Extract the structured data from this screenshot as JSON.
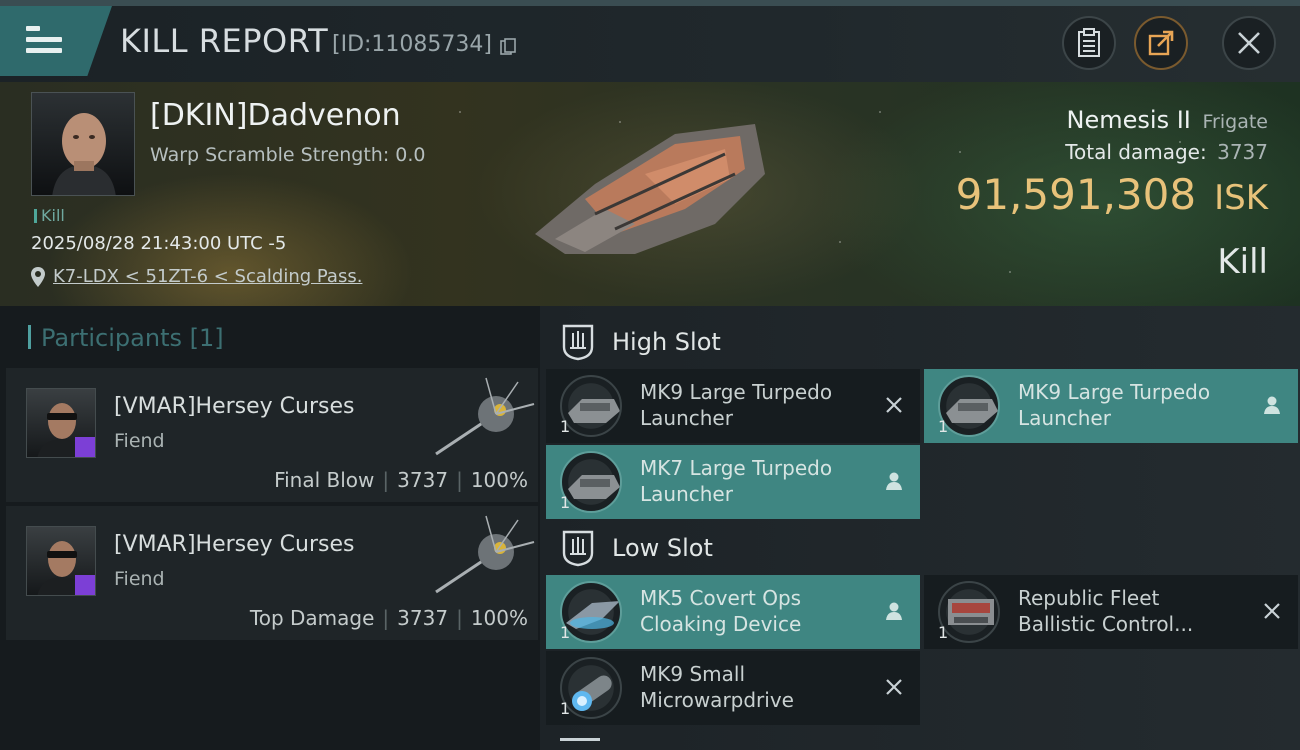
{
  "header": {
    "title": "KILL REPORT",
    "report_id": "[ID:11085734]"
  },
  "victim": {
    "pilot_name": "[DKIN]Dadvenon",
    "warp_scramble": "Warp Scramble Strength: 0.0",
    "kill_tag": "Kill",
    "datetime": "2025/08/28 21:43:00 UTC -5",
    "location": "K7-LDX < 51ZT-6 < Scalding Pass.",
    "ship_name": "Nemesis II",
    "ship_class": "Frigate",
    "total_damage_label": "Total damage:",
    "total_damage": "3737",
    "isk_value": "91,591,308",
    "isk_unit": "ISK",
    "result": "Kill"
  },
  "participants": {
    "header": "Participants [1]",
    "items": [
      {
        "name": "[VMAR]Hersey Curses",
        "ship": "Fiend",
        "role": "Final Blow",
        "damage": "3737",
        "percent": "100%"
      },
      {
        "name": "[VMAR]Hersey Curses",
        "ship": "Fiend",
        "role": "Top Damage",
        "damage": "3737",
        "percent": "100%"
      }
    ]
  },
  "slots": {
    "high": {
      "title": "High Slot",
      "modules": [
        {
          "name": "MK9 Large Turpedo Launcher",
          "qty": "1",
          "highlighted": false,
          "action": "close-icon"
        },
        {
          "name": "MK9 Large Turpedo Launcher",
          "qty": "1",
          "highlighted": true,
          "action": "person-icon"
        },
        {
          "name": "MK7 Large Turpedo Launcher",
          "qty": "1",
          "highlighted": true,
          "action": "person-icon"
        }
      ]
    },
    "low": {
      "title": "Low Slot",
      "modules": [
        {
          "name": "MK5 Covert Ops Cloaking Device",
          "qty": "1",
          "highlighted": true,
          "action": "person-icon"
        },
        {
          "name": "Republic Fleet Ballistic Control...",
          "qty": "1",
          "highlighted": false,
          "action": "close-icon"
        },
        {
          "name": "MK9 Small Microwarpdrive",
          "qty": "1",
          "highlighted": false,
          "action": "close-icon"
        }
      ]
    }
  },
  "colors": {
    "accent_teal": "#3f8682",
    "isk_gold": "#e8c27a",
    "badge_purple": "#7c3fd6"
  }
}
